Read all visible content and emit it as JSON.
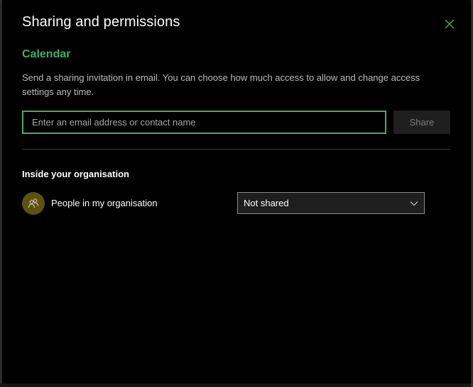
{
  "dialog": {
    "title": "Sharing and permissions",
    "close_icon": "close-icon"
  },
  "calendar": {
    "name": "Calendar",
    "description": "Send a sharing invitation in email. You can choose how much access to allow and change access settings any time."
  },
  "invite": {
    "email_placeholder": "Enter an email address or contact name",
    "email_value": "",
    "share_label": "Share"
  },
  "organisation": {
    "heading": "Inside your organisation",
    "people": {
      "label": "People in my organisation",
      "icon": "people-icon",
      "permission": "Not shared",
      "dropdown_icon": "chevron-down-icon"
    }
  },
  "colors": {
    "accent": "#3fae6a",
    "background": "#000000",
    "avatar": "#5e5210"
  }
}
